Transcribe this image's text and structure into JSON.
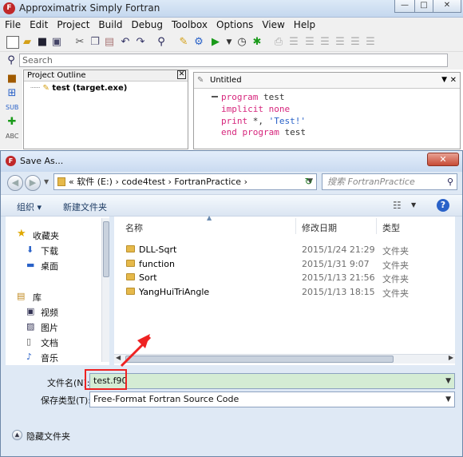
{
  "app": {
    "title": "Approximatrix Simply Fortran",
    "logo": "F",
    "window_buttons": [
      "—",
      "□",
      "✕"
    ]
  },
  "menu": [
    "File",
    "Edit",
    "Project",
    "Build",
    "Debug",
    "Toolbox",
    "Options",
    "View",
    "Help"
  ],
  "search": {
    "placeholder": "Search"
  },
  "outline": {
    "title": "Project Outline",
    "item": "test (target.exe)"
  },
  "editor": {
    "tab": "Untitled",
    "code": {
      "l1_kw": "program",
      "l1_rest": " test",
      "l2": "implicit none",
      "l3_kw": "print",
      "l3_rest": " *, ",
      "l3_str": "'Test!'",
      "l4_kw": "end program",
      "l4_rest": " test"
    }
  },
  "dialog": {
    "title": "Save As...",
    "breadcrumb": "« 软件 (E:) › code4test › FortranPractice ›",
    "search_placeholder": "搜索 FortranPractice",
    "toolbar": {
      "organize": "组织 ▾",
      "new_folder": "新建文件夹"
    },
    "nav": {
      "favorites": "收藏夹",
      "downloads": "下载",
      "desktop": "桌面",
      "library": "库",
      "videos": "视频",
      "pictures": "图片",
      "documents": "文档",
      "music": "音乐"
    },
    "columns": {
      "name": "名称",
      "modified": "修改日期",
      "type": "类型"
    },
    "files": [
      {
        "name": "DLL-Sqrt",
        "date": "2015/1/24 21:29",
        "type": "文件夹"
      },
      {
        "name": "function",
        "date": "2015/1/31 9:07",
        "type": "文件夹"
      },
      {
        "name": "Sort",
        "date": "2015/1/13 21:56",
        "type": "文件夹"
      },
      {
        "name": "YangHuiTriAngle",
        "date": "2015/1/13 18:15",
        "type": "文件夹"
      }
    ],
    "filename_label": "文件名(N):",
    "filename_value": "test.f90",
    "filetype_label": "保存类型(T):",
    "filetype_value": "Free-Format Fortran Source Code",
    "hide_folders": "隐藏文件夹",
    "close": "✕"
  },
  "colors": {
    "annotation": "#ee2222",
    "accent": "#3c7fb1"
  }
}
